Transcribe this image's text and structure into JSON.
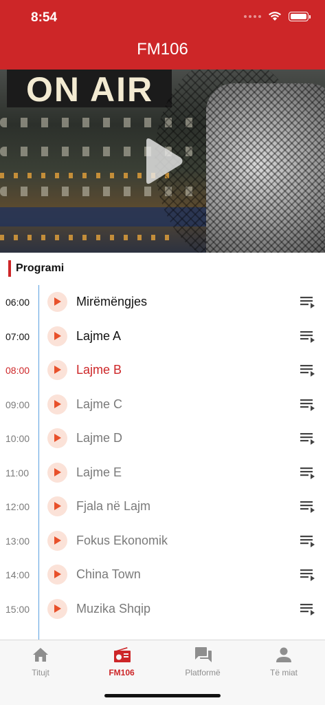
{
  "status_bar": {
    "time": "8:54"
  },
  "header": {
    "title": "FM106",
    "background": "#cd2628"
  },
  "hero": {
    "banner_text": "ON AIR",
    "play_icon": "play-icon"
  },
  "schedule": {
    "section_title": "Programi",
    "items": [
      {
        "time": "06:00",
        "title": "Mirëmëngjes",
        "state": "past"
      },
      {
        "time": "07:00",
        "title": "Lajme A",
        "state": "past"
      },
      {
        "time": "08:00",
        "title": "Lajme B",
        "state": "current"
      },
      {
        "time": "09:00",
        "title": "Lajme C",
        "state": "future"
      },
      {
        "time": "10:00",
        "title": "Lajme D",
        "state": "future"
      },
      {
        "time": "11:00",
        "title": "Lajme E",
        "state": "future"
      },
      {
        "time": "12:00",
        "title": "Fjala në Lajm",
        "state": "future"
      },
      {
        "time": "13:00",
        "title": "Fokus Ekonomik",
        "state": "future"
      },
      {
        "time": "14:00",
        "title": "China Town",
        "state": "future"
      },
      {
        "time": "15:00",
        "title": "Muzika Shqip",
        "state": "future"
      }
    ]
  },
  "tabbar": {
    "tabs": [
      {
        "label": "Titujt",
        "icon": "home-icon",
        "active": false
      },
      {
        "label": "FM106",
        "icon": "radio-icon",
        "active": true
      },
      {
        "label": "Platformë",
        "icon": "chat-icon",
        "active": false
      },
      {
        "label": "Të miat",
        "icon": "person-icon",
        "active": false
      }
    ]
  },
  "colors": {
    "accent": "#cd2628",
    "play_bg": "#fbe2d8",
    "play_fg": "#e8502a",
    "timeline": "#5aa0e0",
    "muted_text": "#7a7a7a"
  }
}
